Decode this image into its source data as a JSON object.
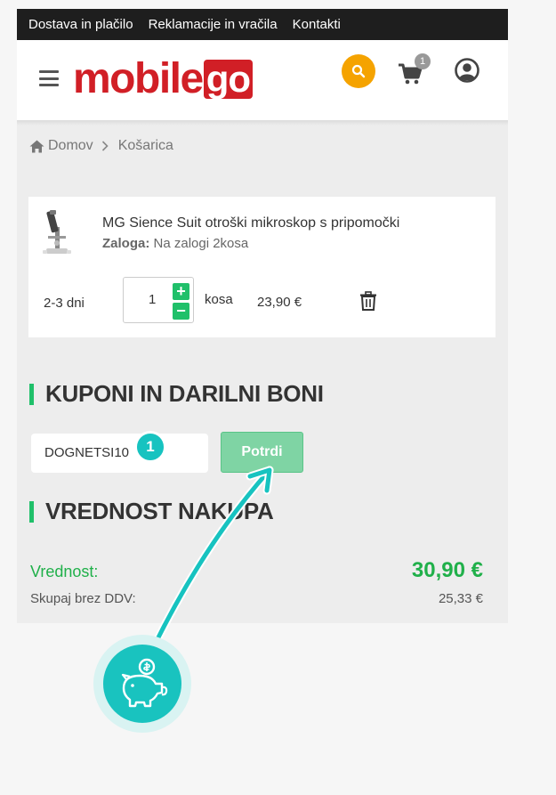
{
  "topbar": {
    "links": [
      "Dostava in plačilo",
      "Reklamacije in vračila",
      "Kontakti"
    ]
  },
  "header": {
    "logo_text": "mobile",
    "logo_box_text": "go",
    "cart_count": "1"
  },
  "breadcrumb": {
    "home": "Domov",
    "current": "Košarica"
  },
  "cart_item": {
    "name": "MG Sience Suit otroški mikroskop s pripomočki",
    "stock_label": "Zaloga:",
    "stock_value": " Na zalogi 2kosa",
    "delivery": "2-3 dni",
    "quantity": "1",
    "unit": "kosa",
    "price": "23,90 €"
  },
  "coupons": {
    "title": "KUPONI IN DARILNI BONI",
    "code": "DOGNETSI10",
    "badge": "1",
    "confirm_label": "Potrdi"
  },
  "summary": {
    "title": "VREDNOST NAKUPA",
    "total_label": "Vrednost:",
    "total_value": "30,90 €",
    "net_label": "Skupaj brez DDV:",
    "net_value": "25,33 €"
  },
  "colors": {
    "brand_red": "#d11f26",
    "accent_green": "#20c06a",
    "annotation_teal": "#17c3c0",
    "search_orange": "#f5a300"
  }
}
